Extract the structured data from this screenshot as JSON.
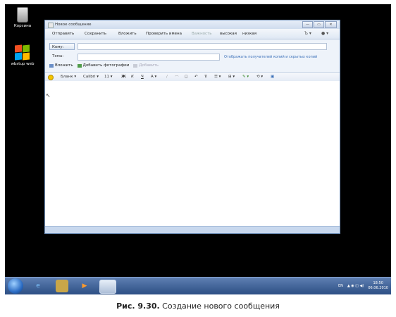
{
  "desktop": {
    "icons": [
      {
        "label": "Корзина"
      },
      {
        "label": "wbstup web"
      }
    ]
  },
  "window": {
    "title": "Новое сообщение",
    "controls": [
      "—",
      "▭",
      "✕"
    ]
  },
  "menubar": {
    "items": [
      "Отправить",
      "Сохранить",
      "Вложить",
      "Проверить имена",
      "Важность",
      "высокая",
      "низкая"
    ],
    "right": [
      "Ъ ▾",
      "● ▾"
    ]
  },
  "headers": {
    "to_label": "Кому:",
    "subject_label": "Тема:",
    "cc_link": "Отображать получателей копий и скрытых копий",
    "attach": {
      "attach_label": "Вложить",
      "photo_label": "Добавить фотографии",
      "dim_label": "Добавить"
    }
  },
  "format": {
    "style": "Бланк ▾",
    "font": "Calibri ▾",
    "size": "11 ▾",
    "buttons": [
      "Ж",
      "К",
      "Ч",
      "А ▾",
      "∕",
      "⌒",
      "◻",
      "↶",
      "⊽",
      "☰ ▾",
      "⊞ ▾",
      "✎ ▾",
      "⟲ ▾",
      "▣"
    ]
  },
  "taskbar": {
    "tray_lang": "EN",
    "tray_icons": "▲ ◉ ◫ ◀)",
    "time": "18:50",
    "date": "06.06.2010"
  },
  "caption": {
    "label": "Рис. 9.30.",
    "text": " Создание нового сообщения"
  },
  "colors": {
    "window_frame": "#6f8fb8",
    "link": "#3a6fb8",
    "desktop": "#000000"
  }
}
